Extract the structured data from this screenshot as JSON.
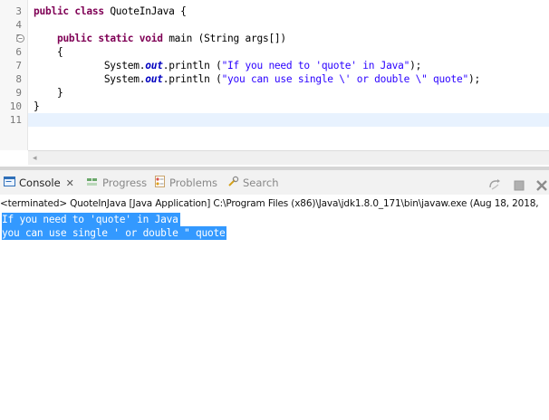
{
  "editor": {
    "lines": [
      {
        "num": "3",
        "segments": [
          {
            "t": "public class",
            "c": "kw"
          },
          {
            "t": " QuoteInJava {",
            "c": ""
          }
        ]
      },
      {
        "num": "4",
        "segments": []
      },
      {
        "num": "5",
        "fold": "⊖",
        "segments": [
          {
            "t": "    ",
            "c": ""
          },
          {
            "t": "public static void",
            "c": "kw"
          },
          {
            "t": " main (String args[])",
            "c": ""
          }
        ]
      },
      {
        "num": "6",
        "segments": [
          {
            "t": "    {",
            "c": ""
          }
        ]
      },
      {
        "num": "7",
        "segments": [
          {
            "t": "            System.",
            "c": ""
          },
          {
            "t": "out",
            "c": "fld"
          },
          {
            "t": ".println (",
            "c": ""
          },
          {
            "t": "\"If you need to 'quote' in Java\"",
            "c": "str"
          },
          {
            "t": ");",
            "c": ""
          }
        ]
      },
      {
        "num": "8",
        "segments": [
          {
            "t": "            System.",
            "c": ""
          },
          {
            "t": "out",
            "c": "fld"
          },
          {
            "t": ".println (",
            "c": ""
          },
          {
            "t": "\"you can use single \\' or double \\\" quote\"",
            "c": "str"
          },
          {
            "t": ");",
            "c": ""
          }
        ]
      },
      {
        "num": "9",
        "segments": [
          {
            "t": "    }",
            "c": ""
          }
        ]
      },
      {
        "num": "10",
        "segments": [
          {
            "t": "}",
            "c": ""
          }
        ]
      },
      {
        "num": "11",
        "segments": []
      }
    ],
    "scroll_left_icon": "◂"
  },
  "console": {
    "tabs": {
      "console": "Console",
      "console_close": "✕",
      "progress": "Progress",
      "problems": "Problems",
      "search": "Search"
    },
    "status": "<terminated> QuoteInJava [Java Application] C:\\Program Files (x86)\\Java\\jdk1.8.0_171\\bin\\javaw.exe (Aug 18, 2018,",
    "output": [
      "If you need to 'quote' in Java",
      "you can use single ' or double \" quote"
    ]
  },
  "colors": {
    "keyword": "#7f0055",
    "string": "#2a00ff",
    "field": "#0000c0",
    "selection": "#3399ff"
  }
}
